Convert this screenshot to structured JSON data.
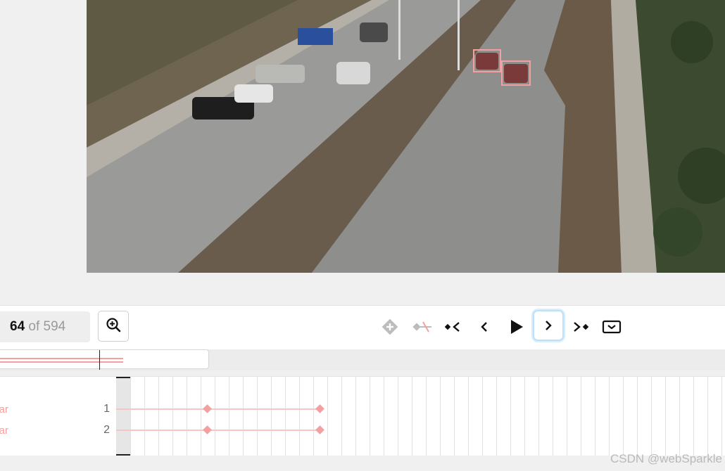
{
  "frame": {
    "current": "64",
    "of_text": " of 594"
  },
  "annotations": [
    {
      "id": "1",
      "label": "Car"
    },
    {
      "id": "2",
      "label": "Car"
    }
  ],
  "track_labels_visible": [
    "ar",
    "ar"
  ],
  "tracks": [
    {
      "number": "1"
    },
    {
      "number": "2"
    }
  ],
  "controls": {
    "add_keyframe": "add-keyframe-icon",
    "remove_keyframe": "remove-keyframe-icon",
    "prev_keyframe": "previous-keyframe-icon",
    "prev_frame": "previous-frame-icon",
    "play": "play-icon",
    "next_frame": "next-frame-icon",
    "next_keyframe": "next-keyframe-icon",
    "toggle_timeline": "collapse-timeline-icon",
    "zoom": "zoom-in-icon"
  },
  "colors": {
    "annotation": "#f4a0a0",
    "active_border": "#bfe0f7"
  },
  "watermark": "CSDN @webSparkle"
}
